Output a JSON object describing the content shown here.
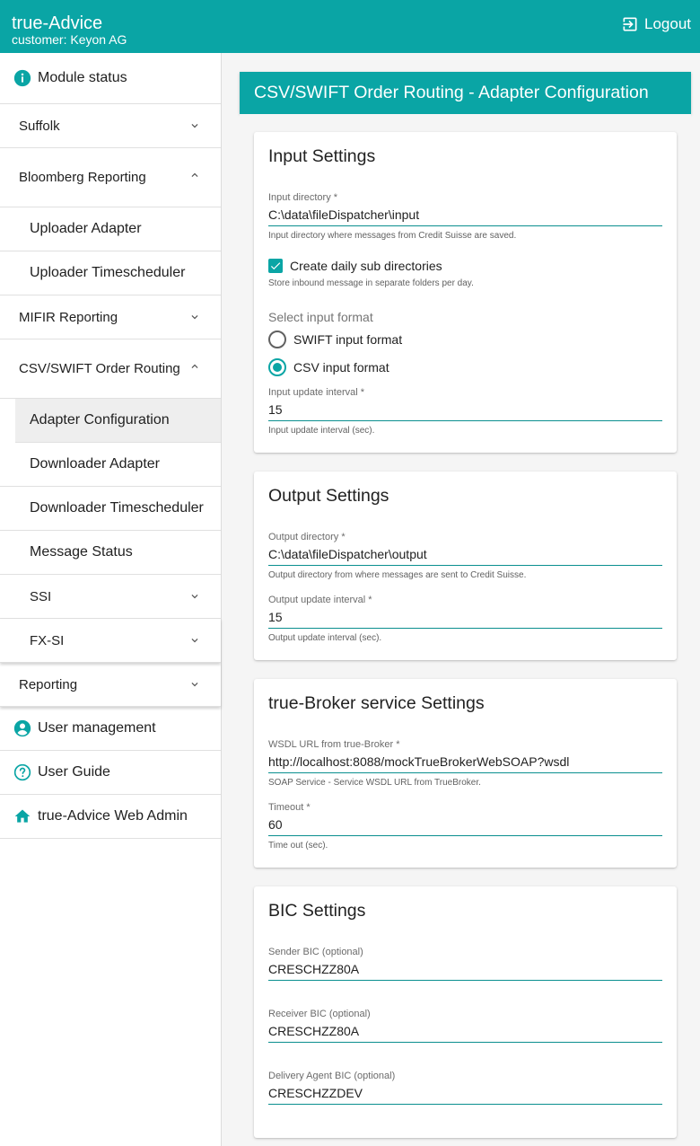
{
  "header": {
    "app_title": "true-Advice",
    "customer": "customer: Keyon AG",
    "logout_label": "Logout"
  },
  "sidebar": {
    "items": [
      {
        "label": "Module status"
      },
      {
        "label": "Suffolk"
      },
      {
        "label": "Bloomberg Reporting"
      },
      {
        "label": "Uploader Adapter"
      },
      {
        "label": "Uploader Timescheduler"
      },
      {
        "label": "MIFIR Reporting"
      },
      {
        "label": "CSV/SWIFT Order Routing"
      },
      {
        "label": "Adapter Configuration"
      },
      {
        "label": "Downloader Adapter"
      },
      {
        "label": "Downloader Timescheduler"
      },
      {
        "label": "Message Status"
      },
      {
        "label": "SSI"
      },
      {
        "label": "FX-SI"
      },
      {
        "label": "Reporting"
      },
      {
        "label": "User management"
      },
      {
        "label": "User Guide"
      },
      {
        "label": "true-Advice Web Admin"
      }
    ]
  },
  "main": {
    "title": "CSV/SWIFT Order Routing - Adapter Configuration",
    "input_settings": {
      "title": "Input Settings",
      "input_dir_label": "Input directory *",
      "input_dir_value": "C:\\data\\fileDispatcher\\input",
      "input_dir_hint": "Input directory where messages from Credit Suisse are saved.",
      "daily_subdirs_label": "Create daily sub directories",
      "daily_subdirs_checked": true,
      "daily_subdirs_hint": "Store inbound message in separate folders per day.",
      "format_group_label": "Select input format",
      "format_swift_label": "SWIFT input format",
      "format_csv_label": "CSV input format",
      "format_selected": "CSV input format",
      "update_interval_label": "Input update interval *",
      "update_interval_value": "15",
      "update_interval_hint": "Input update interval (sec)."
    },
    "output_settings": {
      "title": "Output Settings",
      "output_dir_label": "Output directory *",
      "output_dir_value": "C:\\data\\fileDispatcher\\output",
      "output_dir_hint": "Output directory from where messages are sent to Credit Suisse.",
      "update_interval_label": "Output update interval *",
      "update_interval_value": "15",
      "update_interval_hint": "Output update interval (sec)."
    },
    "broker_settings": {
      "title": "true-Broker service Settings",
      "wsdl_label": "WSDL URL from true-Broker *",
      "wsdl_value": "http://localhost:8088/mockTrueBrokerWebSOAP?wsdl",
      "wsdl_hint": "SOAP Service - Service WSDL URL from TrueBroker.",
      "timeout_label": "Timeout *",
      "timeout_value": "60",
      "timeout_hint": "Time out (sec)."
    },
    "bic_settings": {
      "title": "BIC Settings",
      "sender_label": "Sender BIC (optional)",
      "sender_value": "CRESCHZZ80A",
      "receiver_label": "Receiver BIC (optional)",
      "receiver_value": "CRESCHZZ80A",
      "delivery_label": "Delivery Agent BIC (optional)",
      "delivery_value": "CRESCHZZDEV"
    }
  },
  "colors": {
    "accent": "#0aa5a5",
    "underline": "#0a8f8f"
  }
}
